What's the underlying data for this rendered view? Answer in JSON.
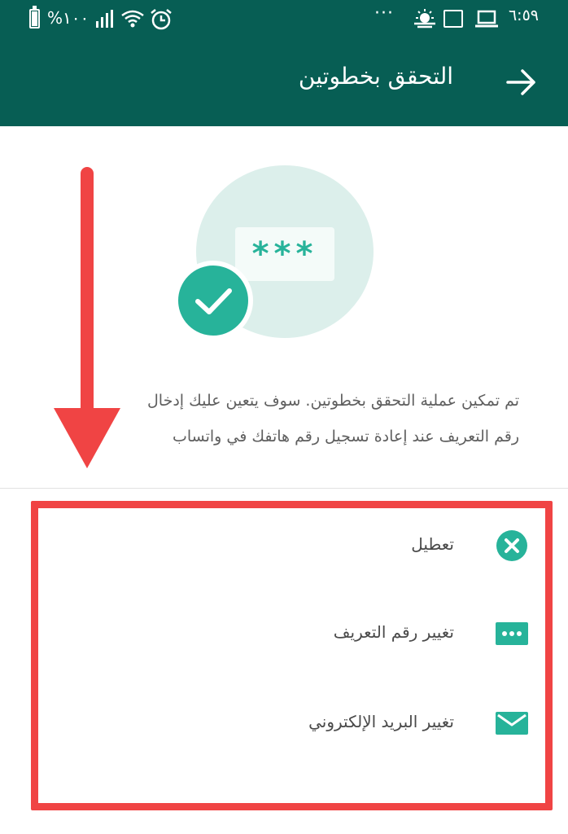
{
  "status_bar": {
    "time": "٦:٥٩",
    "battery": "%١٠٠",
    "overflow_dots": "···"
  },
  "app_bar": {
    "title": "التحقق بخطوتين"
  },
  "illustration": {
    "pin_mask": "***"
  },
  "description": {
    "line1": "تم تمكين عملية التحقق بخطوتين. سوف يتعين عليك إدخال",
    "line2": "رقم التعريف عند إعادة تسجيل رقم هاتفك في واتساب"
  },
  "options": [
    {
      "label": "تعطيل",
      "icon": "close-circle-icon"
    },
    {
      "label": "تغيير رقم التعريف",
      "icon": "pin-dots-icon"
    },
    {
      "label": "تغيير البريد الإلكتروني",
      "icon": "envelope-icon"
    }
  ],
  "colors": {
    "primary": "#075e54",
    "accent": "#27b39a",
    "annotation": "#f04444"
  }
}
